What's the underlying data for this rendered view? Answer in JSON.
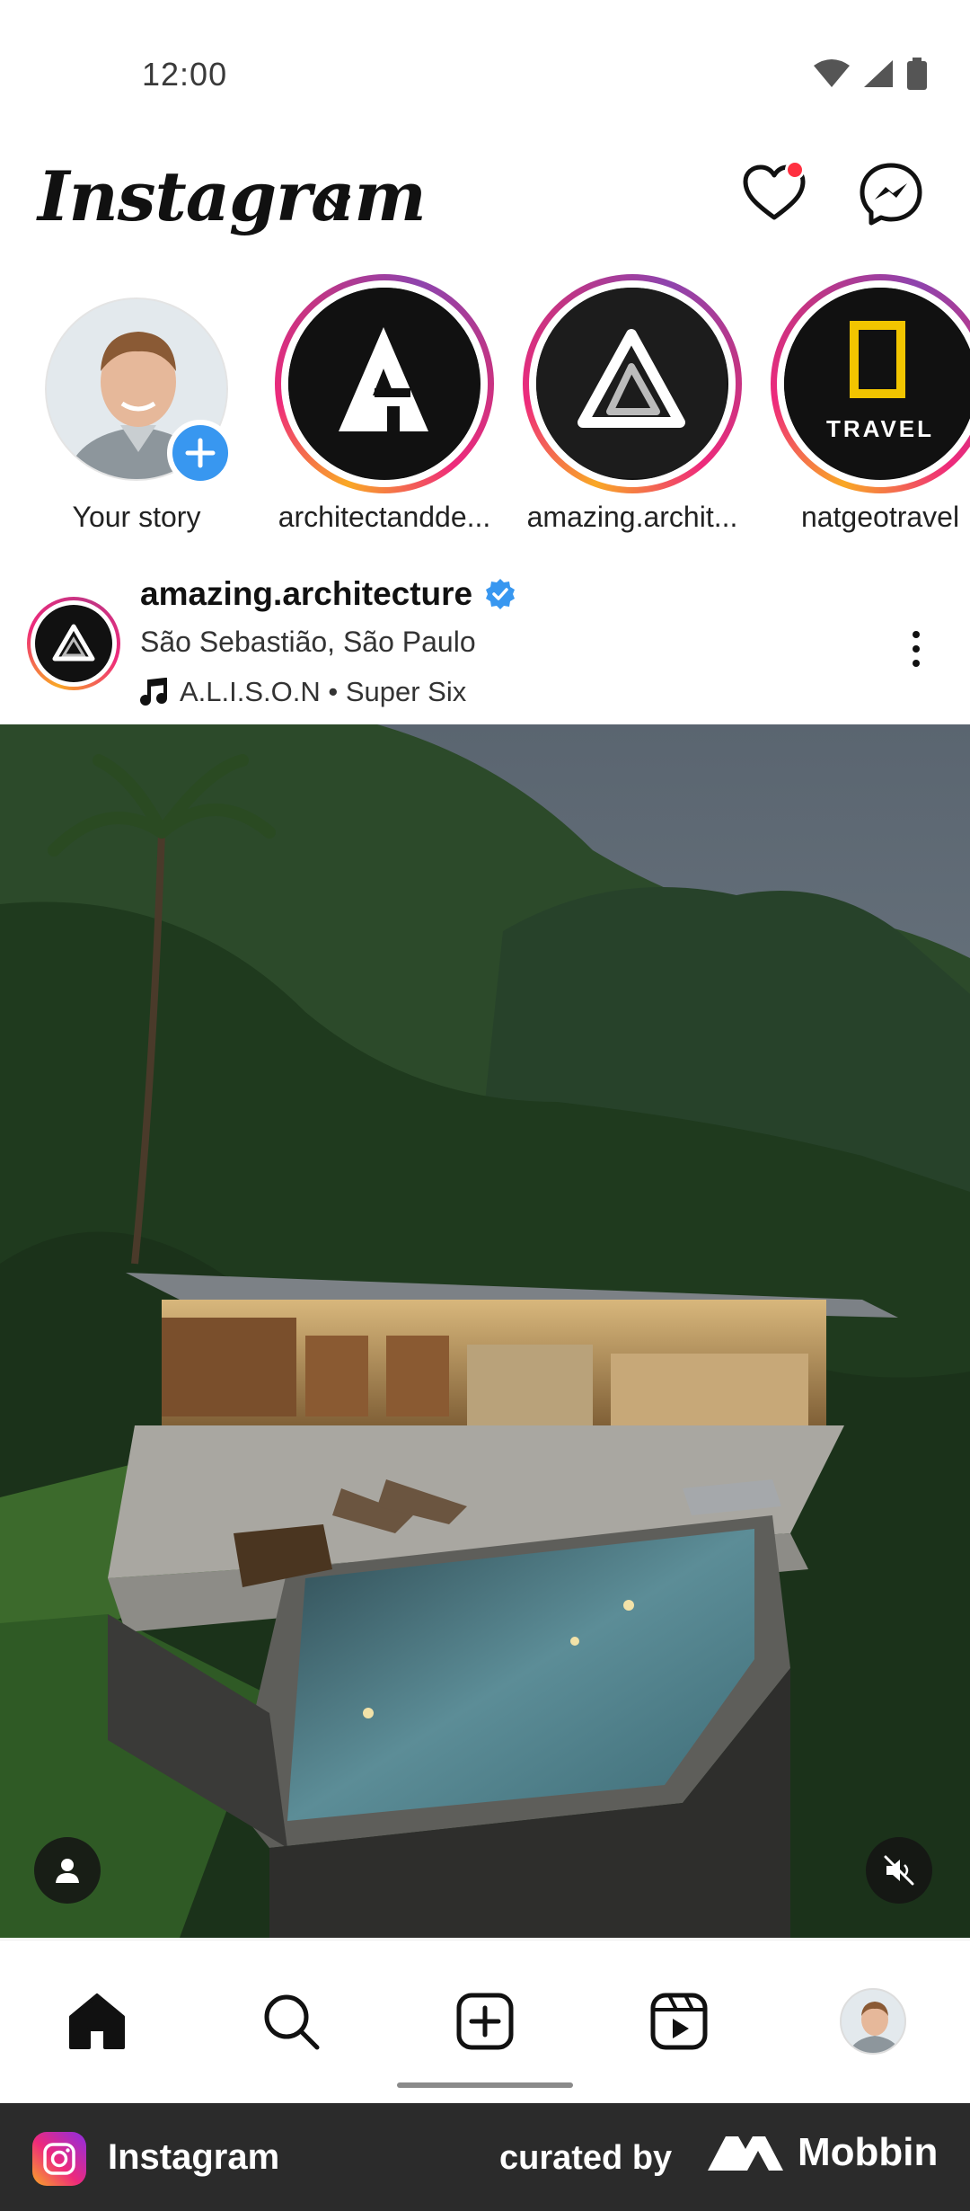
{
  "status_bar": {
    "time": "12:00"
  },
  "header": {
    "app_title": "Instagram"
  },
  "stories": [
    {
      "label": "Your story"
    },
    {
      "label": "architectandde..."
    },
    {
      "label": "amazing.archit..."
    },
    {
      "label": "natgeotravel",
      "avatar_text": "TRAVEL"
    }
  ],
  "post": {
    "username": "amazing.architecture",
    "location": "São Sebastião, São Paulo",
    "audio": "A.L.I.S.O.N • Super Six"
  },
  "footer": {
    "app_name": "Instagram",
    "curated_by": "curated by",
    "brand": "Mobbin"
  },
  "colors": {
    "notification_dot": "#ff3040",
    "verified_badge": "#3897f0",
    "add_story_badge": "#3897f0",
    "footer_background": "#2b2b2b"
  }
}
